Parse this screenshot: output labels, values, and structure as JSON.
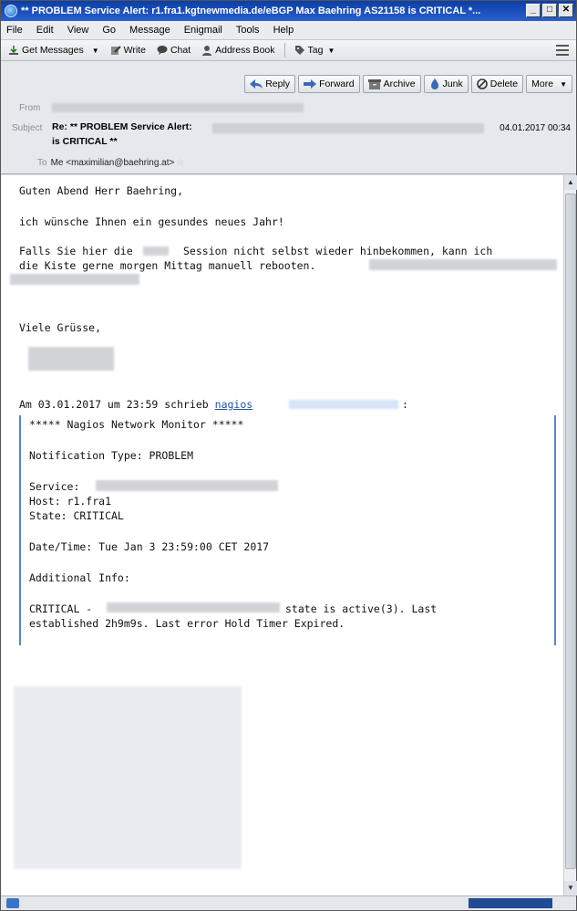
{
  "window": {
    "title": "** PROBLEM Service Alert: r1.fra1.kgtnewmedia.de/eBGP Max Baehring AS21158 is CRITICAL *...",
    "buttons": [
      "_",
      "□",
      "✕"
    ]
  },
  "menubar": [
    "File",
    "Edit",
    "View",
    "Go",
    "Message",
    "Enigmail",
    "Tools",
    "Help"
  ],
  "toolbar": {
    "get_messages": "Get Messages",
    "write": "Write",
    "chat": "Chat",
    "address_book": "Address Book",
    "tag": "Tag"
  },
  "header": {
    "actions": [
      "Reply",
      "Forward",
      "Archive",
      "Junk",
      "Delete",
      "More"
    ],
    "from_label": "From",
    "subject_label": "Subject",
    "subject_line1": "Re: ** PROBLEM Service Alert:",
    "subject_line2": "is CRITICAL **",
    "date": "04.01.2017 00:34",
    "to_label": "To",
    "to_value": "Me <maximilian@baehring.at>"
  },
  "body": {
    "greeting": "Guten Abend Herr Baehring,",
    "wish": "ich wünsche Ihnen ein gesundes neues Jahr!",
    "para1_a": "Falls Sie hier die",
    "para1_b": "Session nicht selbst wieder hinbekommen, kann ich",
    "para1_c": "die Kiste gerne morgen Mittag manuell rebooten.",
    "closing": "Viele Grüsse,",
    "quote_intro": "Am 03.01.2017 um 23:59 schrieb",
    "quote_link": "nagios",
    "quote_colon": ":",
    "quote": {
      "header": "***** Nagios Network Monitor *****",
      "notification": "Notification Type: PROBLEM",
      "service": "Service:",
      "host": "Host: r1.fra1",
      "state": "State: CRITICAL",
      "datetime": "Date/Time: Tue Jan 3 23:59:00 CET 2017",
      "additional": "Additional Info:",
      "critical_a": "CRITICAL -",
      "critical_b": "state is active(3). Last",
      "critical_c": "established 2h9m9s. Last error Hold Timer Expired."
    }
  }
}
